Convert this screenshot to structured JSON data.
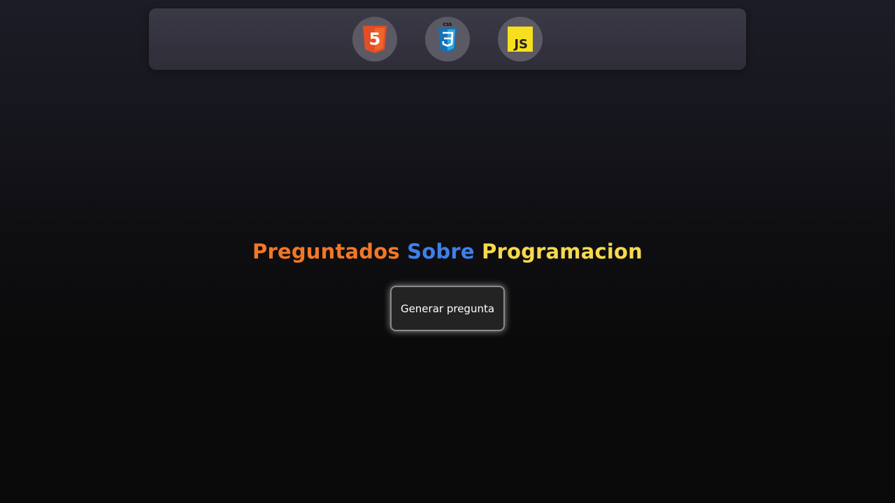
{
  "nav": {
    "icons": [
      {
        "name": "html5-icon",
        "badge_text": "5",
        "color": "#e44d26"
      },
      {
        "name": "css3-icon",
        "badge_text": "CSS",
        "color": "#1572b6"
      },
      {
        "name": "javascript-icon",
        "badge_text": "JS",
        "color": "#f7df1e"
      }
    ]
  },
  "title": {
    "part1": "Preguntados",
    "part2": "Sobre",
    "part3": "Programacion",
    "colors": [
      "#f37726",
      "#3f80ea",
      "#f7d94c"
    ]
  },
  "actions": {
    "generate_label": "Generar pregunta"
  }
}
